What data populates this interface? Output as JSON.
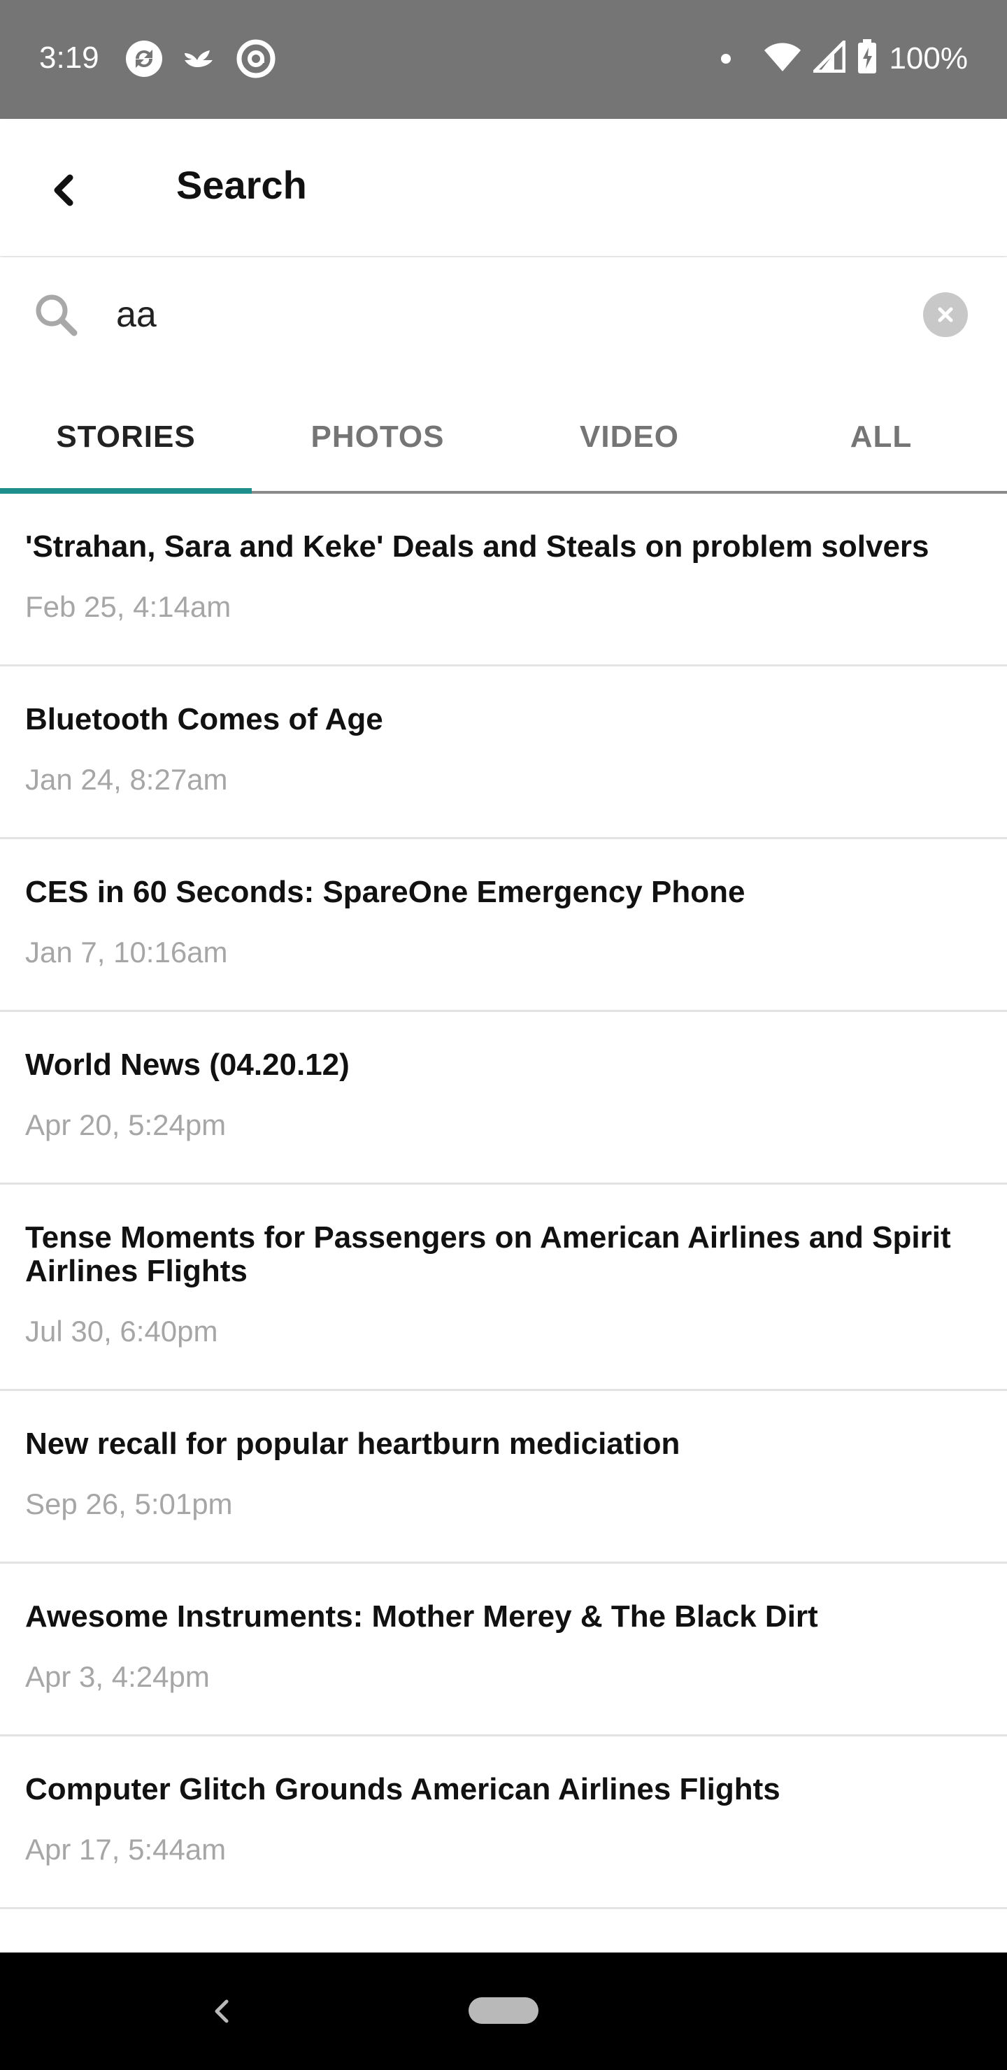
{
  "status_bar": {
    "time": "3:19",
    "battery": "100%",
    "icons": [
      "sync-icon",
      "bird-icon",
      "at-icon",
      "notification-dot-icon",
      "wifi-icon",
      "cell-signal-icon",
      "battery-charging-icon"
    ]
  },
  "app_bar": {
    "back_icon": "chevron-left-icon",
    "title": "Search"
  },
  "search": {
    "value": "aa",
    "placeholder": "",
    "icons": [
      "search-icon",
      "clear-icon"
    ]
  },
  "tabs": [
    {
      "label": "STORIES",
      "active": true
    },
    {
      "label": "PHOTOS",
      "active": false
    },
    {
      "label": "VIDEO",
      "active": false
    },
    {
      "label": "ALL",
      "active": false
    }
  ],
  "colors": {
    "status_bar_bg": "#757575",
    "accent": "#1e8f8c",
    "date_text": "#a6a6a6"
  },
  "results": [
    {
      "title": "'Strahan, Sara and Keke' Deals and Steals on problem solvers",
      "date": "Feb 25, 4:14am"
    },
    {
      "title": "Bluetooth Comes of Age",
      "date": "Jan 24, 8:27am"
    },
    {
      "title": "CES in 60 Seconds: SpareOne Emergency Phone",
      "date": "Jan 7, 10:16am"
    },
    {
      "title": "World News (04.20.12)",
      "date": "Apr 20, 5:24pm"
    },
    {
      "title": "Tense Moments for Passengers on American Airlines and Spirit Airlines Flights",
      "date": "Jul 30, 6:40pm"
    },
    {
      "title": "New recall for popular heartburn mediciation",
      "date": "Sep 26, 5:01pm"
    },
    {
      "title": "Awesome Instruments: Mother Merey & The Black Dirt",
      "date": "Apr 3, 4:24pm"
    },
    {
      "title": "Computer Glitch Grounds American Airlines Flights",
      "date": "Apr 17, 5:44am"
    }
  ],
  "nav_bar": {
    "icons": [
      "nav-back-icon",
      "nav-home-pill-icon"
    ]
  }
}
